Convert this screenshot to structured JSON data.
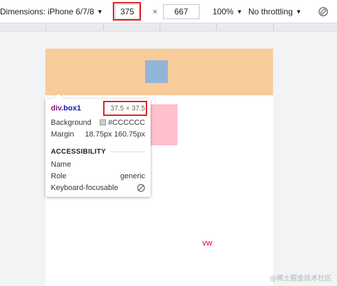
{
  "toolbar": {
    "dimensions_label": "Dimensions: iPhone 6/7/8",
    "width_value": "375",
    "times_sign": "×",
    "height_value": "667",
    "zoom_label": "100%",
    "throttle_label": "No throttling",
    "rotate_icon": "rotate-icon",
    "highlight_color": "#e02020"
  },
  "page": {
    "vw_text": "vw",
    "colors": {
      "orange_band": "#f8cb9b",
      "box1": "#93b4d9",
      "pink_box": "#ffc0cb",
      "vw_text": "#e8001c"
    }
  },
  "tooltip": {
    "element_tag": "div",
    "element_class": ".box1",
    "size": "37.5 × 37.5",
    "background_label": "Background",
    "background_value": "#CCCCCC",
    "margin_label": "Margin",
    "margin_value": "18.75px 160.75px",
    "accessibility_heading": "ACCESSIBILITY",
    "name_label": "Name",
    "role_label": "Role",
    "role_value": "generic",
    "focusable_label": "Keyboard-focusable",
    "focusable_icon": "no-entry-icon"
  },
  "watermark": "@稀土掘金技术社区"
}
